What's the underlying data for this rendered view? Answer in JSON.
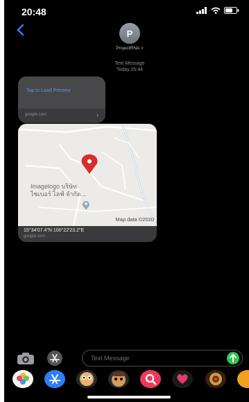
{
  "status_bar": {
    "time": "20:48"
  },
  "header": {
    "avatar_initial": "P",
    "contact_name": "ProjectRNA >",
    "timestamp_line1": "Text Message",
    "timestamp_line2": "Today 20:44"
  },
  "link_preview": {
    "title": "Tap to Load Preview",
    "domain": "google.com"
  },
  "map_preview": {
    "place_line1": "Imagelogo บริษัท",
    "place_line2": "ไซเบอร์ ไลฟ์ จำกัด...",
    "attribution": "Map data ©2020",
    "coordinates": "15°34'07.4\"N 100°22'23.2\"E",
    "domain": "google.com"
  },
  "composer": {
    "placeholder": "Text Message"
  },
  "app_drawer": {
    "icons": [
      "photos-icon",
      "app-store-icon",
      "memoji-icon",
      "animoji-icon",
      "search-images-icon",
      "digital-touch-icon",
      "music-icon",
      "more-apps-icon"
    ]
  },
  "colors": {
    "background": "#000000",
    "bubble": "#3a3a3c",
    "link": "#6f8fd8",
    "send": "#30c553",
    "pin": "#d62d2d"
  }
}
